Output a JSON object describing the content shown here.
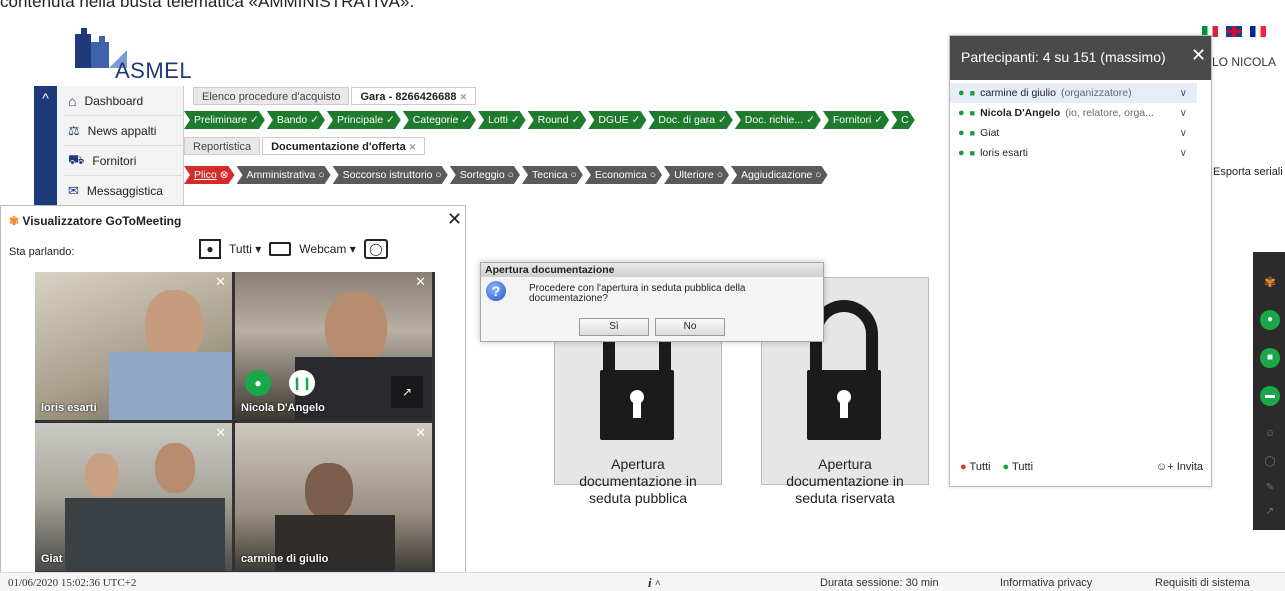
{
  "document_text": "contenuta nella busta telematica «AMMINISTRATIVA».",
  "app": {
    "logo_text": "ASMEL"
  },
  "sidebar": {
    "items": [
      {
        "label": "Dashboard",
        "icon": "home-icon"
      },
      {
        "label": "News appalti",
        "icon": "scales-icon"
      },
      {
        "label": "Fornitori",
        "icon": "truck-icon"
      },
      {
        "label": "Messaggistica",
        "icon": "message-icon"
      }
    ]
  },
  "top_tabs": [
    {
      "label": "Elenco procedure d'acquisto",
      "active": false
    },
    {
      "label": "Gara - 8266426688",
      "active": true
    }
  ],
  "green_steps": [
    "Preliminare",
    "Bando",
    "Principale",
    "Categorie",
    "Lotti",
    "Round",
    "DGUE",
    "Doc. di gara",
    "Doc. richie...",
    "Fornitori",
    "C"
  ],
  "sub_tabs": [
    {
      "label": "Reportistica",
      "active": false
    },
    {
      "label": "Documentazione d'offerta",
      "active": true
    }
  ],
  "red_steps": [
    "Plico",
    "Amministrativa",
    "Soccorso istruttorio",
    "Sorteggio",
    "Tecnica",
    "Economica",
    "Ulteriore",
    "Aggiudicazione"
  ],
  "esporta": "Esporta seriali",
  "cards": [
    {
      "label_1": "Apertura",
      "label_2": "documentazione in",
      "label_3": "seduta pubblica"
    },
    {
      "label_1": "Apertura",
      "label_2": "documentazione in",
      "label_3": "seduta riservata"
    }
  ],
  "dialog": {
    "title": "Apertura documentazione",
    "message_1": "Procedere con l'apertura in seduta pubblica della",
    "message_2": "documentazione?",
    "yes": "Sì",
    "no": "No"
  },
  "gotomeeting": {
    "title": "Visualizzatore GoToMeeting",
    "speaking": "Sta parlando:",
    "filter": "Tutti",
    "webcam": "Webcam",
    "videos": [
      {
        "name": "loris esarti"
      },
      {
        "name": "Nicola D'Angelo"
      },
      {
        "name": "Giat"
      },
      {
        "name": "carmine di giulio"
      }
    ]
  },
  "participants": {
    "header": "Partecipanti: 4 su 151 (massimo)",
    "list": [
      {
        "name": "carmine di giulio",
        "role": "(organizzatore)"
      },
      {
        "name": "Nicola D'Angelo",
        "role": "(io, relatore, orga..."
      },
      {
        "name": "Giat",
        "role": ""
      },
      {
        "name": "loris esarti",
        "role": ""
      }
    ],
    "mute_all": "Tutti",
    "unmute_all": "Tutti",
    "invite": "Invita"
  },
  "behind_text": "LO NICOLA",
  "statusbar": {
    "datetime": "01/06/2020 15:02:36 UTC+2",
    "info": "i",
    "duration": "Durata sessione: 30 min",
    "privacy": "Informativa privacy",
    "requirements": "Requisiti di sistema"
  },
  "colors": {
    "brand": "#1e3a7a",
    "step_done": "#1e7b2e",
    "step_active": "#d42b2b",
    "step_pending": "#5a5a5a",
    "goto_green": "#18a84a"
  }
}
